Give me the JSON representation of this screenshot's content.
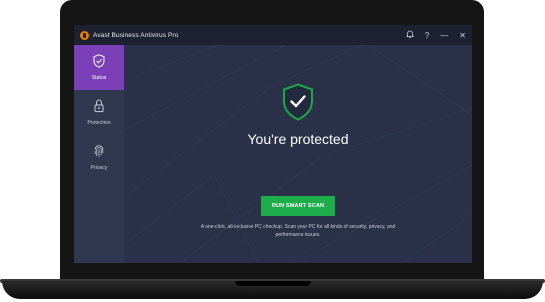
{
  "window": {
    "title": "Avast Business Antivirus Pro",
    "controls": {
      "notifications_icon": "bell-icon",
      "help_icon": "help-icon",
      "minimize_icon": "minimize-icon",
      "close_icon": "close-icon",
      "help_glyph": "?",
      "minimize_glyph": "—",
      "close_glyph": "✕"
    }
  },
  "sidebar": {
    "items": [
      {
        "label": "Status",
        "icon": "shield-check-icon",
        "active": true
      },
      {
        "label": "Protection",
        "icon": "lock-icon",
        "active": false
      },
      {
        "label": "Privacy",
        "icon": "fingerprint-icon",
        "active": false
      }
    ]
  },
  "main": {
    "status_icon": "shield-check-icon",
    "headline": "You're protected",
    "scan_button_label": "RUN SMART SCAN",
    "description": "A one-click, all-inclusive PC checkup. Scan your PC for all kinds of security, privacy, and performance issues."
  },
  "colors": {
    "accent_purple": "#7b3fb8",
    "scan_green": "#1dae4b",
    "shield_green": "#1aa84a",
    "background": "#2a3148",
    "sidebar": "#303850",
    "titlebar": "#1d2233"
  }
}
